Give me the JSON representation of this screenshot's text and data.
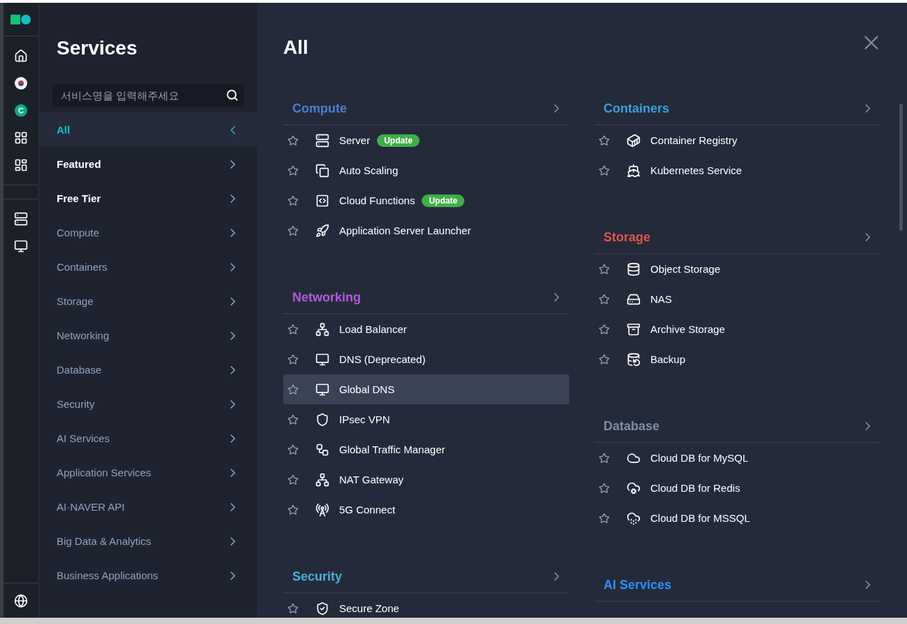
{
  "rail": {
    "avatar": "C"
  },
  "sidebar": {
    "title": "Services",
    "search": {
      "placeholder": "서비스명을 입력해주세요"
    },
    "items": [
      {
        "label": "All",
        "kind": "pinned",
        "selected": true
      },
      {
        "label": "Featured",
        "kind": "pinned",
        "selected": false
      },
      {
        "label": "Free Tier",
        "kind": "pinned",
        "selected": false
      },
      {
        "label": "Compute",
        "kind": "category",
        "selected": false
      },
      {
        "label": "Containers",
        "kind": "category",
        "selected": false
      },
      {
        "label": "Storage",
        "kind": "category",
        "selected": false
      },
      {
        "label": "Networking",
        "kind": "category",
        "selected": false
      },
      {
        "label": "Database",
        "kind": "category",
        "selected": false
      },
      {
        "label": "Security",
        "kind": "category",
        "selected": false
      },
      {
        "label": "AI Services",
        "kind": "category",
        "selected": false
      },
      {
        "label": "Application Services",
        "kind": "category",
        "selected": false
      },
      {
        "label": "AI·NAVER API",
        "kind": "category",
        "selected": false
      },
      {
        "label": "Big Data & Analytics",
        "kind": "category",
        "selected": false
      },
      {
        "label": "Business Applications",
        "kind": "category",
        "selected": false
      }
    ]
  },
  "main": {
    "title": "All",
    "columns": [
      [
        {
          "title": "Compute",
          "color": "#4a7fd4",
          "items": [
            {
              "label": "Server",
              "badge": "Update",
              "selected": false
            },
            {
              "label": "Auto Scaling",
              "selected": false
            },
            {
              "label": "Cloud Functions",
              "badge": "Update",
              "selected": false
            },
            {
              "label": "Application Server Launcher",
              "selected": false
            }
          ]
        },
        {
          "title": "Networking",
          "color": "#b05be0",
          "items": [
            {
              "label": "Load Balancer",
              "selected": false
            },
            {
              "label": "DNS (Deprecated)",
              "selected": false
            },
            {
              "label": "Global DNS",
              "selected": true
            },
            {
              "label": "IPsec VPN",
              "selected": false
            },
            {
              "label": "Global Traffic Manager",
              "selected": false
            },
            {
              "label": "NAT Gateway",
              "selected": false
            },
            {
              "label": "5G Connect",
              "selected": false
            }
          ]
        },
        {
          "title": "Security",
          "color": "#4ab0d8",
          "items": [
            {
              "label": "Secure Zone",
              "selected": false
            }
          ]
        }
      ],
      [
        {
          "title": "Containers",
          "color": "#3a9fd8",
          "items": [
            {
              "label": "Container Registry",
              "selected": false
            },
            {
              "label": "Kubernetes Service",
              "selected": false
            }
          ]
        },
        {
          "title": "Storage",
          "color": "#e0564a",
          "items": [
            {
              "label": "Object Storage",
              "selected": false
            },
            {
              "label": "NAS",
              "selected": false
            },
            {
              "label": "Archive Storage",
              "selected": false
            },
            {
              "label": "Backup",
              "selected": false
            }
          ]
        },
        {
          "title": "Database",
          "color": "#7f8ea3",
          "items": [
            {
              "label": "Cloud DB for MySQL",
              "selected": false
            },
            {
              "label": "Cloud DB for Redis",
              "selected": false
            },
            {
              "label": "Cloud DB for MSSQL",
              "selected": false
            }
          ]
        },
        {
          "title": "AI Services",
          "color": "#2e8fff"
        }
      ]
    ]
  }
}
